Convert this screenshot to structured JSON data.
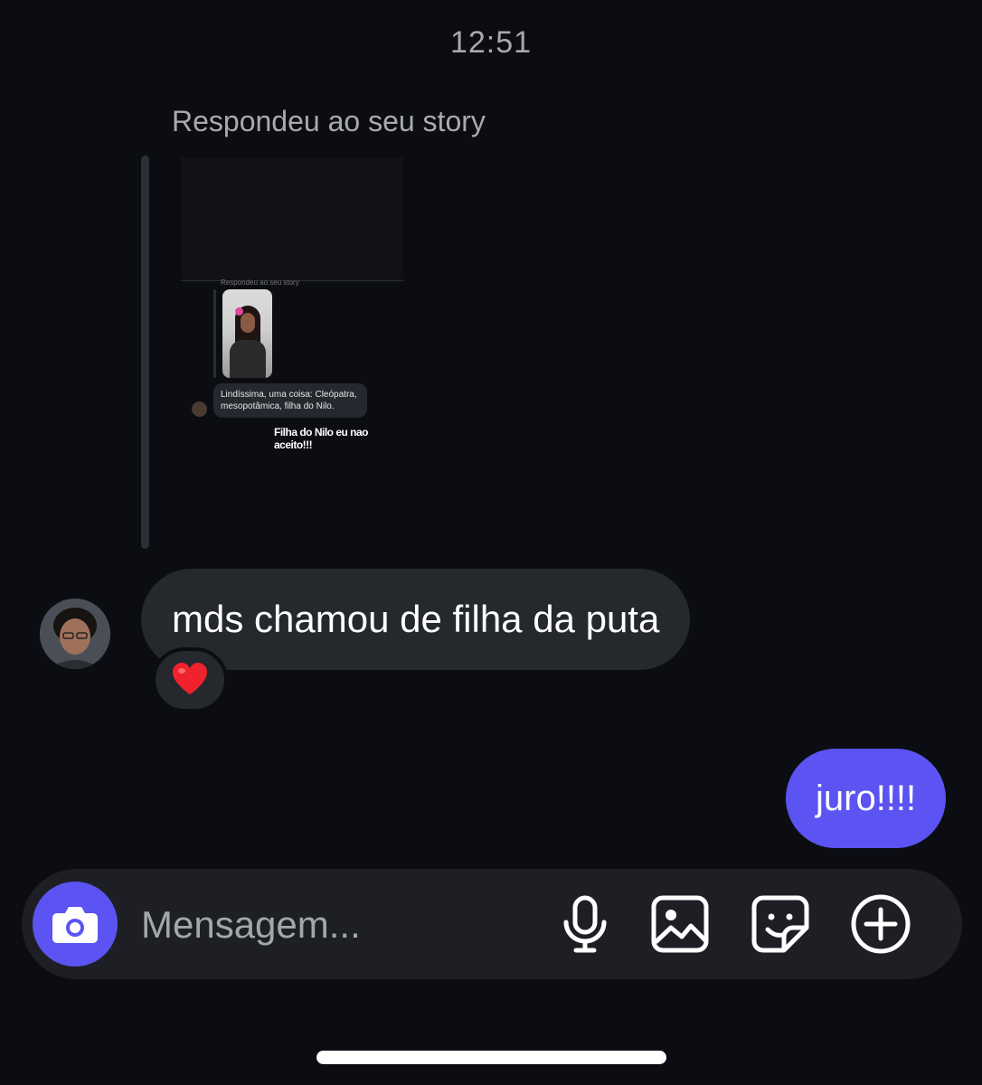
{
  "header": {
    "time": "12:51"
  },
  "story_reply": {
    "label": "Respondeu ao seu story",
    "thumbnail": {
      "mini_label": "Respondeu ao seu story",
      "mini_message": "Lindíssima, uma coisa: Cleópatra, mesopotâmica, filha do Nilo.",
      "caption": "Filha do Nilo eu nao aceito!!!"
    }
  },
  "messages": [
    {
      "direction": "incoming",
      "text": "mds chamou de filha da puta",
      "reaction": "❤️"
    },
    {
      "direction": "outgoing",
      "text": "juro!!!!"
    }
  ],
  "composer": {
    "placeholder": "Mensagem...",
    "icons": [
      "camera-icon",
      "microphone-icon",
      "gallery-icon",
      "sticker-icon",
      "add-icon"
    ]
  },
  "colors": {
    "background": "#0b0d12",
    "incoming_bubble": "#25282d",
    "outgoing_bubble": "#5b54f2",
    "accent": "#5b54f2"
  }
}
